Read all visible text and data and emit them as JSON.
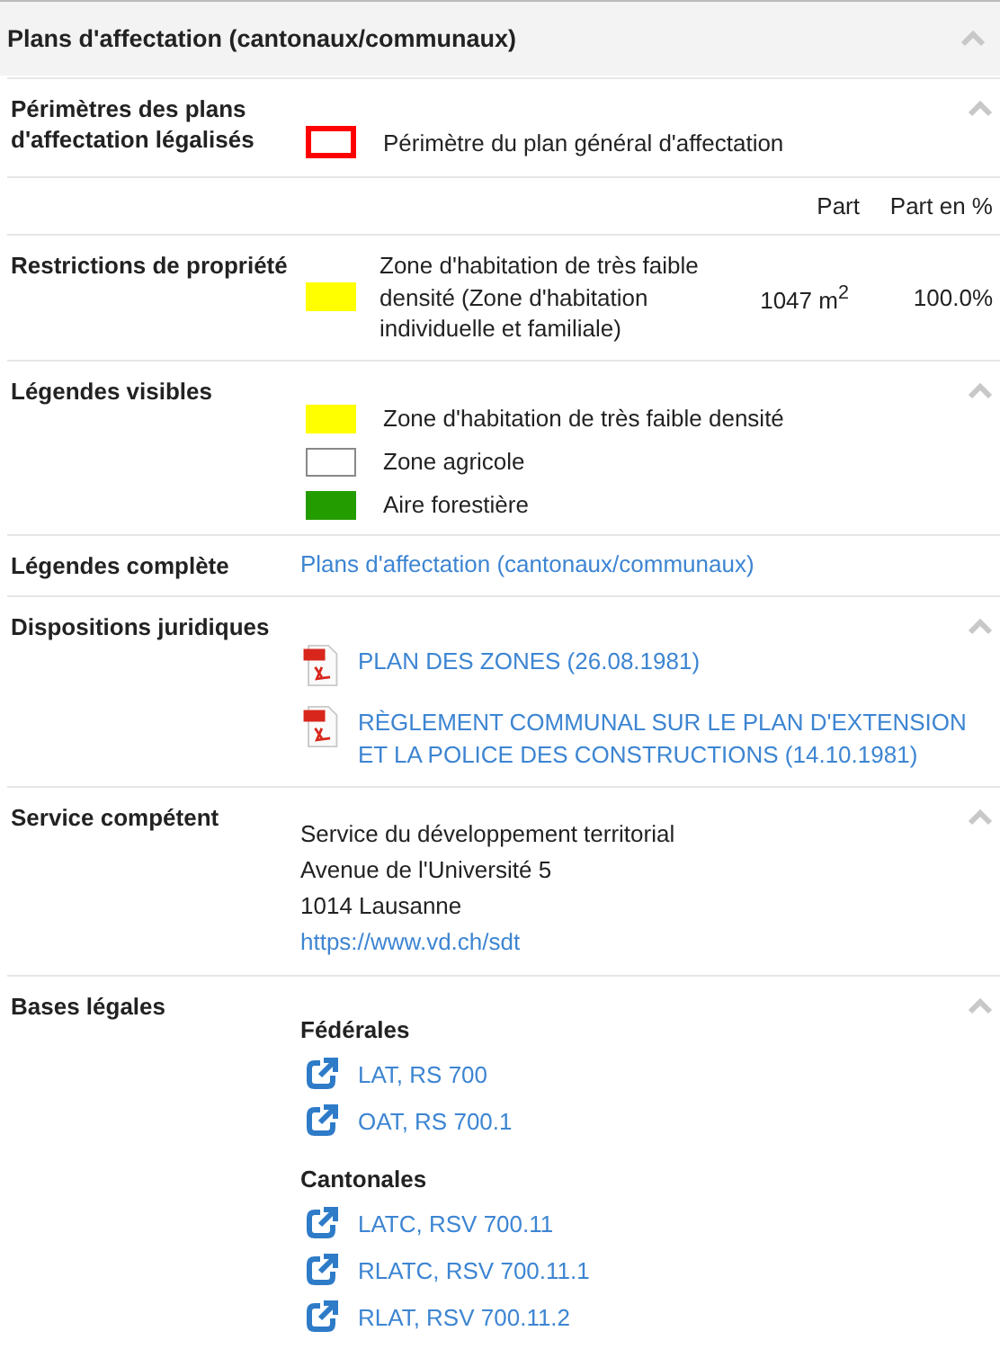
{
  "panel": {
    "title": "Plans d'affectation (cantonaux/communaux)",
    "expanded": true
  },
  "sections": [
    {
      "kind": "legend",
      "label": "Périmètres des plans d'affectation légalisés",
      "collapsible": true,
      "items": [
        {
          "kind": "outline",
          "color": "#ff0000",
          "text": "Périmètre du plan général d'affectation"
        }
      ]
    },
    {
      "kind": "table_header",
      "columns": [
        "Part",
        "Part en %"
      ]
    },
    {
      "kind": "restriction",
      "label": "Restrictions de propriété",
      "items": [
        {
          "kind": "fill",
          "color": "#ffff00",
          "text": "Zone d'habitation de très faible densité (Zone d'habitation individuelle et familiale)",
          "area": "1047 m$^{2}$",
          "share": "100.0%"
        }
      ]
    },
    {
      "kind": "legend",
      "label": "Légendes visibles",
      "collapsible": true,
      "items": [
        {
          "kind": "fill",
          "color": "#ffff00",
          "text": "Zone d'habitation de très faible densité"
        },
        {
          "kind": "fill",
          "color": "#ffffff",
          "text": "Zone agricole"
        },
        {
          "kind": "fill",
          "color": "#239c00",
          "text": "Aire forestière"
        }
      ]
    },
    {
      "kind": "link",
      "label": "Légendes complète",
      "collapsible": false,
      "link": "Plans d'affectation (cantonaux/communaux)"
    },
    {
      "kind": "documents",
      "label": "Dispositions juridiques",
      "collapsible": true,
      "items": [
        "PLAN DES ZONES (26.08.1981)",
        "RÈGLEMENT COMMUNAL SUR LE PLAN D'EXTENSION ET LA POLICE DES CONSTRUCTIONS (14.10.1981)"
      ]
    },
    {
      "kind": "address",
      "label": "Service compétent",
      "collapsible": true,
      "lines": [
        "Service du développement territorial",
        "Avenue de l'Université 5",
        "1014 Lausanne"
      ],
      "link": "https://www.vd.ch/sdt"
    },
    {
      "kind": "laws",
      "label": "Bases légales",
      "collapsible": true,
      "groups": [
        {
          "title": "Fédérales",
          "links": [
            "LAT, RS 700",
            "OAT, RS 700.1"
          ]
        },
        {
          "title": "Cantonales",
          "links": [
            "LATC, RSV 700.11",
            "RLATC, RSV 700.11.1",
            "RLAT, RSV 700.11.2"
          ]
        }
      ]
    }
  ]
}
